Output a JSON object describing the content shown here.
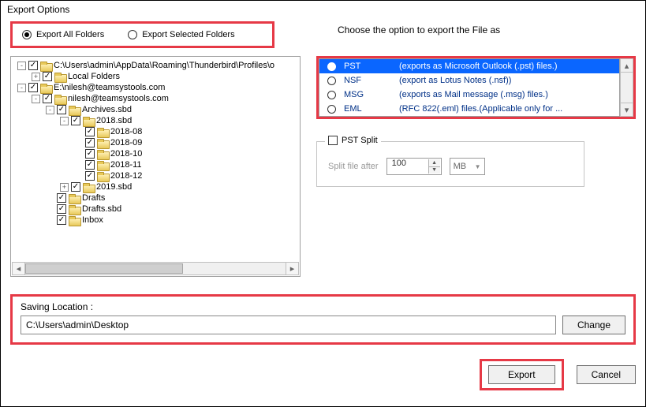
{
  "window": {
    "title": "Export Options"
  },
  "radios": {
    "allFolders": "Export All Folders",
    "selectedFolders": "Export Selected Folders",
    "selected": "allFolders"
  },
  "tree": [
    {
      "indent": 0,
      "exp": "-",
      "checked": true,
      "label": "C:\\Users\\admin\\AppData\\Roaming\\Thunderbird\\Profiles\\o"
    },
    {
      "indent": 1,
      "exp": "+",
      "checked": true,
      "label": "Local Folders"
    },
    {
      "indent": 0,
      "exp": "-",
      "checked": true,
      "label": "E:\\nilesh@teamsystools.com"
    },
    {
      "indent": 1,
      "exp": "-",
      "checked": true,
      "label": "nilesh@teamsystools.com"
    },
    {
      "indent": 2,
      "exp": "-",
      "checked": true,
      "label": "Archives.sbd"
    },
    {
      "indent": 3,
      "exp": "-",
      "checked": true,
      "label": "2018.sbd"
    },
    {
      "indent": 4,
      "exp": "",
      "checked": true,
      "label": "2018-08"
    },
    {
      "indent": 4,
      "exp": "",
      "checked": true,
      "label": "2018-09"
    },
    {
      "indent": 4,
      "exp": "",
      "checked": true,
      "label": "2018-10"
    },
    {
      "indent": 4,
      "exp": "",
      "checked": true,
      "label": "2018-11"
    },
    {
      "indent": 4,
      "exp": "",
      "checked": true,
      "label": "2018-12"
    },
    {
      "indent": 3,
      "exp": "+",
      "checked": true,
      "label": "2019.sbd"
    },
    {
      "indent": 2,
      "exp": "",
      "checked": true,
      "label": "Drafts"
    },
    {
      "indent": 2,
      "exp": "",
      "checked": true,
      "label": "Drafts.sbd"
    },
    {
      "indent": 2,
      "exp": "",
      "checked": true,
      "label": "Inbox"
    }
  ],
  "chooseLabel": "Choose the option to export the File as",
  "formats": [
    {
      "name": "PST",
      "desc": "(exports as Microsoft Outlook (.pst) files.)",
      "selected": true
    },
    {
      "name": "NSF",
      "desc": "(export as Lotus Notes (.nsf))",
      "selected": false
    },
    {
      "name": "MSG",
      "desc": "(exports as Mail message (.msg) files.)",
      "selected": false
    },
    {
      "name": "EML",
      "desc": "(RFC 822(.eml) files.(Applicable only for ...",
      "selected": false
    }
  ],
  "split": {
    "title": "PST Split",
    "afterLabel": "Split file after",
    "value": "100",
    "unit": "MB"
  },
  "saving": {
    "label": "Saving Location :",
    "path": "C:\\Users\\admin\\Desktop",
    "changeBtn": "Change"
  },
  "buttons": {
    "export": "Export",
    "cancel": "Cancel"
  }
}
